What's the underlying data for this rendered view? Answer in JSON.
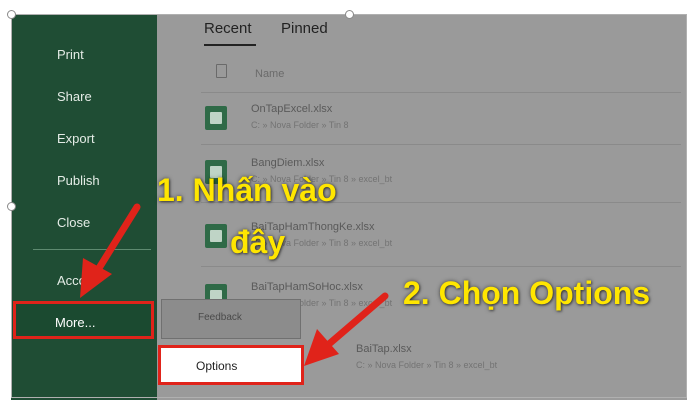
{
  "sidebar": {
    "items": [
      {
        "label": "Print"
      },
      {
        "label": "Share"
      },
      {
        "label": "Export"
      },
      {
        "label": "Publish"
      },
      {
        "label": "Close"
      },
      {
        "label": "Acco"
      }
    ],
    "more_label": "More..."
  },
  "tabs": {
    "recent": "Recent",
    "pinned": "Pinned"
  },
  "file_list": {
    "header": "Name",
    "files": [
      {
        "name": "OnTapExcel.xlsx",
        "path": "C: » Nova Folder » Tin 8"
      },
      {
        "name": "BangDiem.xlsx",
        "path": "C: » Nova Folder » Tin 8 » excel_bt"
      },
      {
        "name": "BaiTapHamThongKe.xlsx",
        "path": "C: » Nova Folder » Tin 8 » excel_bt"
      },
      {
        "name": "BaiTapHamSoHoc.xlsx",
        "path": "C: » Nova Folder » Tin 8 » excel_bt"
      },
      {
        "name": "BaiTap.xlsx",
        "path": "C: » Nova Folder » Tin 8 » excel_bt"
      }
    ]
  },
  "feedback_label": "Feedback",
  "options_label": "Options",
  "annotations": {
    "step1_line1": "1. Nhấn vào",
    "step1_line2": "đây",
    "step2": "2. Chọn Options"
  },
  "colors": {
    "sidebar_green": "#1f4d34",
    "highlight_red": "#e0231a",
    "annotation_yellow": "#ffe600"
  }
}
